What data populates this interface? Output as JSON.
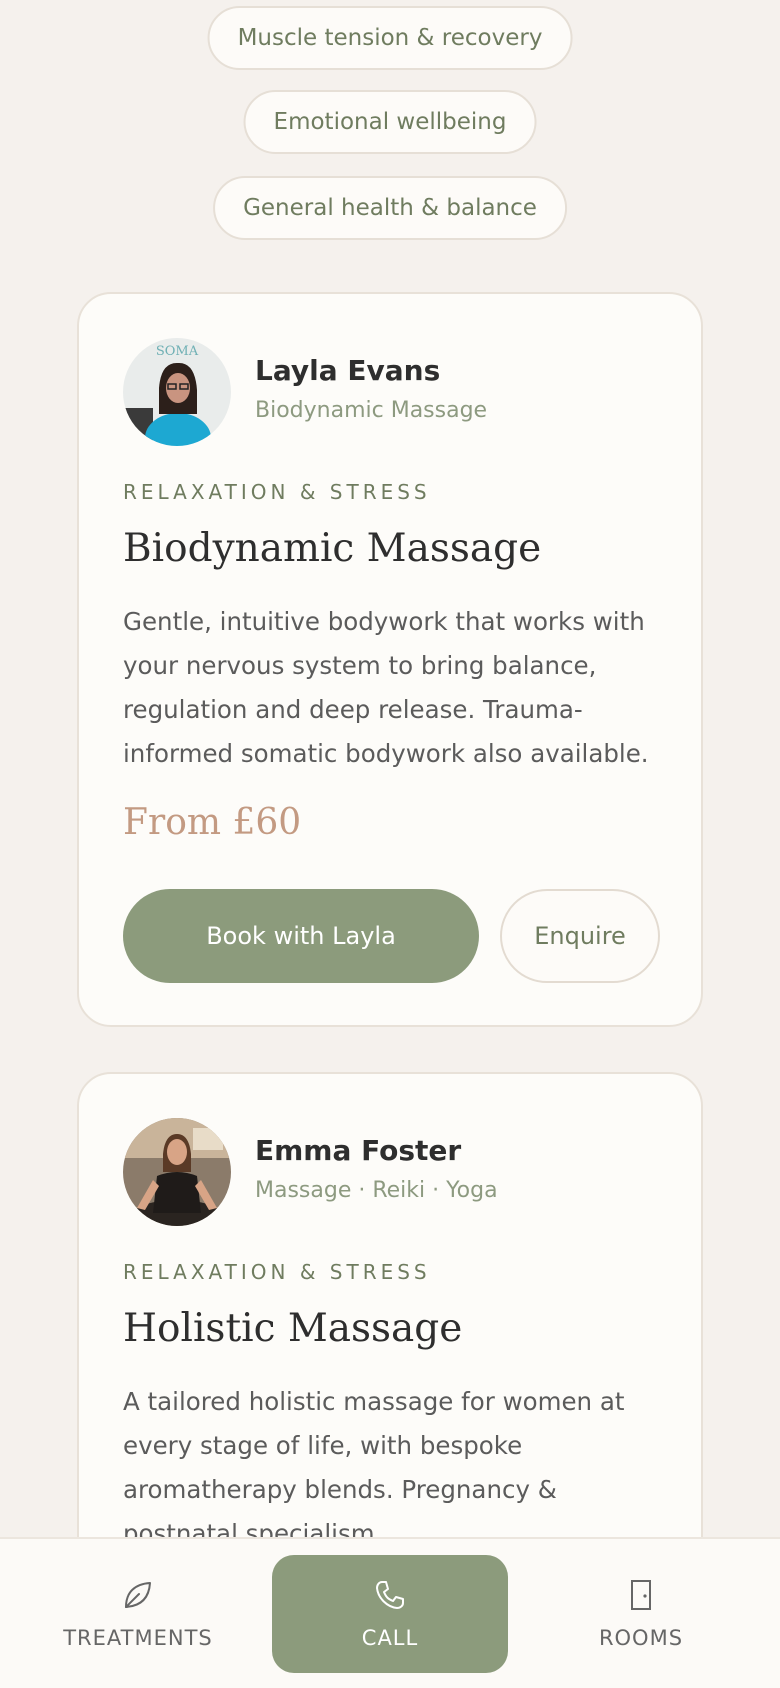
{
  "filters": [
    {
      "label": "Muscle tension & recovery"
    },
    {
      "label": "Emotional wellbeing"
    },
    {
      "label": "General health & balance"
    }
  ],
  "cards": [
    {
      "practitioner": "Layla Evans",
      "role": "Biodynamic Massage",
      "avatar_sign": "SOMA",
      "category": "RELAXATION & STRESS",
      "title": "Biodynamic Massage",
      "description": "Gentle, intuitive bodywork that works with your nervous system to bring balance, regulation and deep release. Trauma-informed somatic bodywork also available.",
      "price": "From £60",
      "book_label": "Book with Layla",
      "enquire_label": "Enquire"
    },
    {
      "practitioner": "Emma Foster",
      "role": "Massage · Reiki · Yoga",
      "category": "RELAXATION & STRESS",
      "title": "Holistic Massage",
      "description": "A tailored holistic massage for women at every stage of life, with bespoke aromatherapy blends. Pregnancy & postnatal specialism."
    }
  ],
  "bottom_nav": {
    "treatments": "TREATMENTS",
    "call": "CALL",
    "rooms": "ROOMS"
  },
  "colors": {
    "accent": "#8c9b7c",
    "price": "#c39a82",
    "background": "#f5f1ed"
  }
}
